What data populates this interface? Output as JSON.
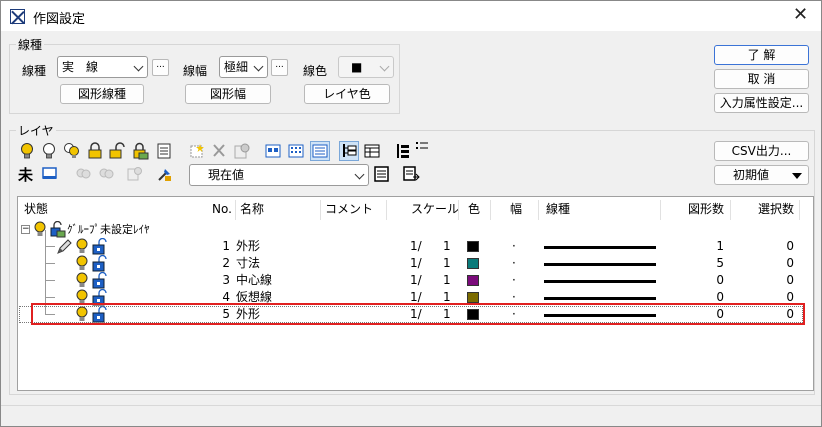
{
  "window": {
    "title": "作図設定",
    "close_glyph": "✕"
  },
  "dialog_buttons": {
    "ok": "了 解",
    "cancel": "取 消",
    "input_attr": "入力属性設定..."
  },
  "line_group": {
    "legend": "線種",
    "linetype_label": "線種",
    "linetype_value": "実　線",
    "linewidth_label": "線幅",
    "linewidth_value": "極細",
    "linecolor_label": "線色",
    "linecolor_value": "■",
    "ellipsis": "...",
    "btn_shape_linetype": "図形線種",
    "btn_shape_width": "図形幅",
    "btn_layer_color": "レイヤ色"
  },
  "layer_group": {
    "legend": "レイヤ",
    "row1_left_text": "未",
    "view_value": "現在値",
    "csv_button": "CSV出力...",
    "initial_value": "初期値"
  },
  "table": {
    "headers": [
      "状態",
      "No.",
      "名称",
      "コメント",
      "スケール",
      "色",
      "幅",
      "線種",
      "図形数",
      "選択数"
    ],
    "group_label": "ｸﾞﾙｰﾌﾟ未設定ﾚｲﾔ",
    "rows": [
      {
        "no": "1",
        "name": "外形",
        "scale_a": "1/",
        "scale_b": "1",
        "color": "#000000",
        "width": "·",
        "count": "1",
        "selected": "0"
      },
      {
        "no": "2",
        "name": "寸法",
        "scale_a": "1/",
        "scale_b": "1",
        "color": "#0b7b7b",
        "width": "·",
        "count": "5",
        "selected": "0"
      },
      {
        "no": "3",
        "name": "中心線",
        "scale_a": "1/",
        "scale_b": "1",
        "color": "#7b0b7b",
        "width": "·",
        "count": "0",
        "selected": "0"
      },
      {
        "no": "4",
        "name": "仮想線",
        "scale_a": "1/",
        "scale_b": "1",
        "color": "#7b6b00",
        "width": "·",
        "count": "0",
        "selected": "0"
      },
      {
        "no": "5",
        "name": "外形",
        "scale_a": "1/",
        "scale_b": "1",
        "color": "#000000",
        "width": "·",
        "count": "0",
        "selected": "0"
      }
    ]
  },
  "colors": {
    "accent": "#3b73d6",
    "highlight": "#e02020",
    "bulb": "#f2c400",
    "lock": "#1d5fc4"
  }
}
